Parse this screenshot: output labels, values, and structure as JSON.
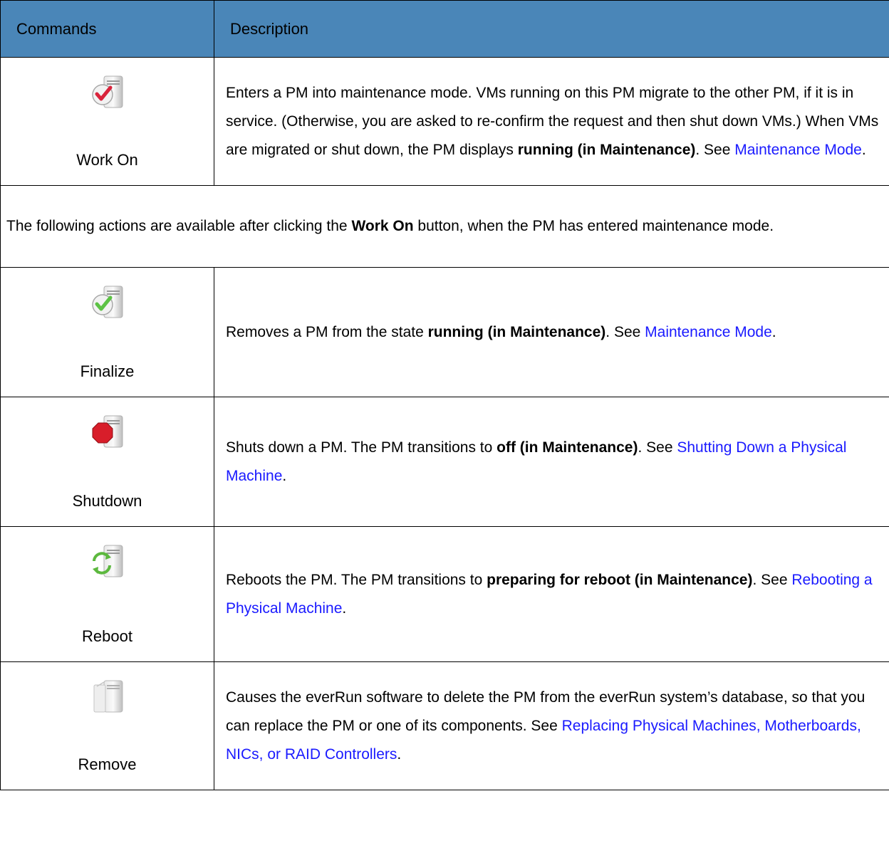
{
  "header": {
    "col1": "Commands",
    "col2": "Description"
  },
  "rows": [
    {
      "command": "Work On",
      "icon": "server-check-red-icon",
      "desc": [
        {
          "t": "Enters a PM into maintenance mode. VMs running on this PM migrate to the other PM, if it is in service. (Otherwise, you are asked to re-confirm the request and then shut down VMs.) When VMs are migrated or shut down, the PM displays "
        },
        {
          "t": "running (in Maintenance)",
          "s": "strong"
        },
        {
          "t": ". See "
        },
        {
          "t": "Maintenance Mode",
          "s": "link"
        },
        {
          "t": "."
        }
      ]
    },
    {
      "note": [
        {
          "t": "The following actions are available after clicking the "
        },
        {
          "t": "Work On",
          "s": "strong"
        },
        {
          "t": " button, when the PM has entered maintenance mode."
        }
      ]
    },
    {
      "command": "Finalize",
      "icon": "server-check-green-icon",
      "desc": [
        {
          "t": "Removes a PM from the state "
        },
        {
          "t": "running (in Maintenance)",
          "s": "strong"
        },
        {
          "t": ". See "
        },
        {
          "t": "Maintenance Mode",
          "s": "link"
        },
        {
          "t": "."
        }
      ]
    },
    {
      "command": "Shutdown",
      "icon": "server-stop-icon",
      "desc": [
        {
          "t": "Shuts down a PM. The PM transitions to "
        },
        {
          "t": "off (in Maintenance)",
          "s": "strong"
        },
        {
          "t": ". See "
        },
        {
          "t": "Shutting Down a Physical Machine",
          "s": "link"
        },
        {
          "t": "."
        }
      ]
    },
    {
      "command": "Reboot",
      "icon": "server-reboot-icon",
      "desc": [
        {
          "t": "Reboots the PM. The PM transitions to "
        },
        {
          "t": "preparing for reboot (in Maintenance)",
          "s": "strong"
        },
        {
          "t": ". See "
        },
        {
          "t": "Rebooting a Physical Machine",
          "s": "link"
        },
        {
          "t": "."
        }
      ]
    },
    {
      "command": "Remove",
      "icon": "server-remove-icon",
      "desc": [
        {
          "t": "Causes the everRun software to delete the PM from the everRun system’s database, so that you can replace the PM or one of its components. See "
        },
        {
          "t": "Replacing Physical Machines, Motherboards, NICs, or RAID Controllers",
          "s": "link"
        },
        {
          "t": "."
        }
      ]
    }
  ]
}
